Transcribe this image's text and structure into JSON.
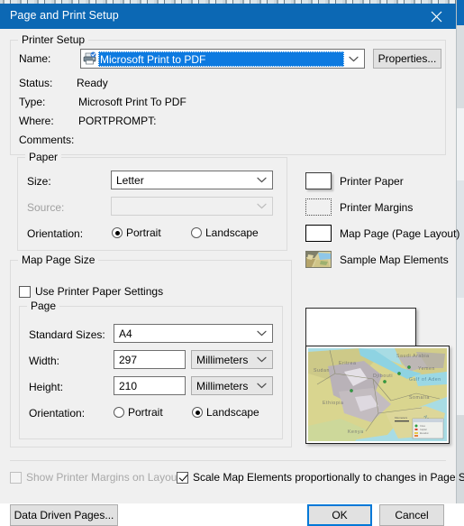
{
  "window": {
    "title": "Page and Print Setup",
    "close_icon": "close-icon",
    "titlebar_color": "#0c68b4"
  },
  "printer_setup": {
    "group_title": "Printer Setup",
    "name_label": "Name:",
    "name_value": "Microsoft Print to PDF",
    "name_icon": "printer-icon",
    "properties_button": "Properties...",
    "status_label": "Status:",
    "status_value": "Ready",
    "type_label": "Type:",
    "type_value": "Microsoft Print To PDF",
    "where_label": "Where:",
    "where_value": "PORTPROMPT:",
    "comments_label": "Comments:",
    "comments_value": "",
    "selection_color": "#0d7ae0"
  },
  "paper": {
    "group_title": "Paper",
    "size_label": "Size:",
    "size_value": "Letter",
    "source_label": "Source:",
    "source_value": "",
    "source_disabled": true,
    "orientation_label": "Orientation:",
    "orientation_options": [
      "Portrait",
      "Landscape"
    ],
    "orientation_selected": "Portrait"
  },
  "legend": {
    "items": [
      {
        "label": "Printer Paper",
        "icon": "paper-swatch-icon"
      },
      {
        "label": "Printer Margins",
        "icon": "margins-swatch-icon"
      },
      {
        "label": "Map Page (Page Layout)",
        "icon": "map-page-swatch-icon"
      },
      {
        "label": "Sample Map Elements",
        "icon": "sample-map-swatch-icon"
      }
    ]
  },
  "map_page_size": {
    "group_title": "Map Page Size",
    "use_printer_paper_settings_label": "Use Printer Paper Settings",
    "use_printer_paper_settings_checked": false,
    "page": {
      "group_title": "Page",
      "standard_sizes_label": "Standard Sizes:",
      "standard_sizes_value": "A4",
      "width_label": "Width:",
      "width_value": "297",
      "width_units": "Millimeters",
      "height_label": "Height:",
      "height_value": "210",
      "height_units": "Millimeters",
      "orientation_label": "Orientation:",
      "orientation_options": [
        "Portrait",
        "Landscape"
      ],
      "orientation_selected": "Landscape"
    }
  },
  "preview": {
    "name": "page-layout-preview",
    "map_region": "Horn of Africa"
  },
  "footer": {
    "show_margins_label": "Show Printer Margins on Layout",
    "show_margins_checked": false,
    "show_margins_disabled": true,
    "scale_elements_label": "Scale Map Elements proportionally to changes in Page Size",
    "scale_elements_checked": true,
    "data_driven_pages_button": "Data Driven Pages...",
    "ok_button": "OK",
    "cancel_button": "Cancel"
  }
}
